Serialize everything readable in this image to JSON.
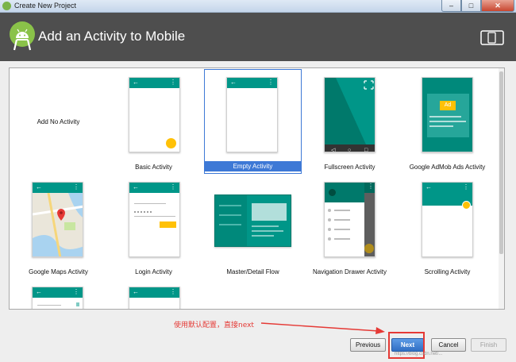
{
  "window": {
    "title": "Create New Project",
    "min": "–",
    "max": "□",
    "close": "✕"
  },
  "header": {
    "title": "Add an Activity to Mobile"
  },
  "tiles": [
    {
      "label": "Add No Activity"
    },
    {
      "label": "Basic Activity"
    },
    {
      "label": "Empty Activity",
      "selected": true
    },
    {
      "label": "Fullscreen Activity"
    },
    {
      "label": "Google AdMob Ads Activity",
      "ad_badge": "Ad"
    },
    {
      "label": "Google Maps Activity"
    },
    {
      "label": "Login Activity"
    },
    {
      "label": "Master/Detail Flow"
    },
    {
      "label": "Navigation Drawer Activity"
    },
    {
      "label": "Scrolling Activity"
    }
  ],
  "annotation": {
    "text": "使用默认配置，直接next"
  },
  "buttons": {
    "previous": "Previous",
    "next": "Next",
    "cancel": "Cancel",
    "finish": "Finish"
  },
  "watermark": "https://blog.csdn.net/...",
  "colors": {
    "accent": "#009688",
    "selection": "#3e79d6",
    "header": "#4e4e4e",
    "annotation": "#e53935",
    "fab": "#ffc107"
  }
}
